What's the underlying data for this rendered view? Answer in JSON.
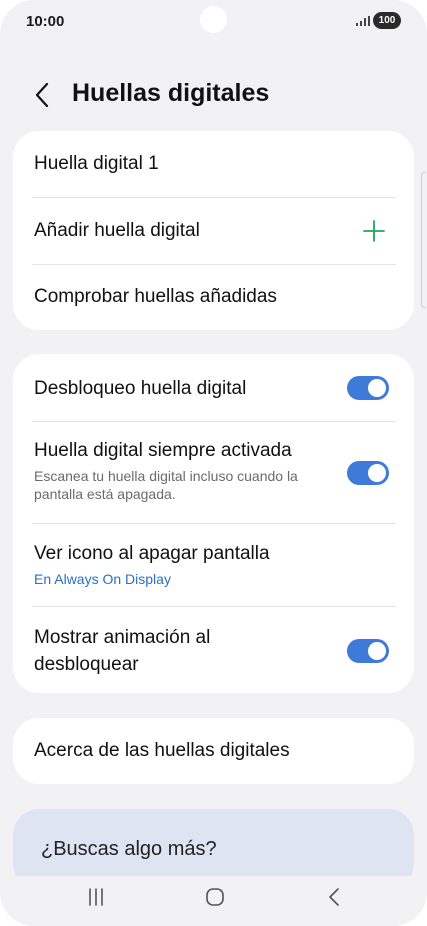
{
  "status_bar": {
    "time": "10:00",
    "battery": "100",
    "icons": [
      "signal-icon"
    ]
  },
  "header": {
    "title": "Huellas digitales",
    "back_icon": "chevron-left-icon"
  },
  "card1": {
    "items": [
      {
        "label": "Huella digital 1"
      },
      {
        "label": "Añadir huella digital",
        "icon": "plus-icon"
      },
      {
        "label": "Comprobar huellas añadidas"
      }
    ]
  },
  "card2": {
    "items": [
      {
        "label": "Desbloqueo huella digital",
        "toggle": true
      },
      {
        "label": "Huella digital siempre activada",
        "subtitle": "Escanea tu huella digital incluso cuando la pantalla está apagada.",
        "toggle": true
      },
      {
        "label": "Ver icono al apagar pantalla",
        "link": "En Always On Display"
      },
      {
        "label": "Mostrar animación al desbloquear",
        "toggle": true
      }
    ]
  },
  "card3": {
    "label": "Acerca de las huellas digitales"
  },
  "search_card": {
    "label": "¿Buscas algo más?"
  },
  "nav_bar": {
    "icons": [
      "recents-icon",
      "home-icon",
      "back-icon"
    ]
  },
  "colors": {
    "accent": "#3e7bd9",
    "plus": "#1fa65a",
    "link": "#2a6fc9",
    "background": "#f2f2f4"
  }
}
